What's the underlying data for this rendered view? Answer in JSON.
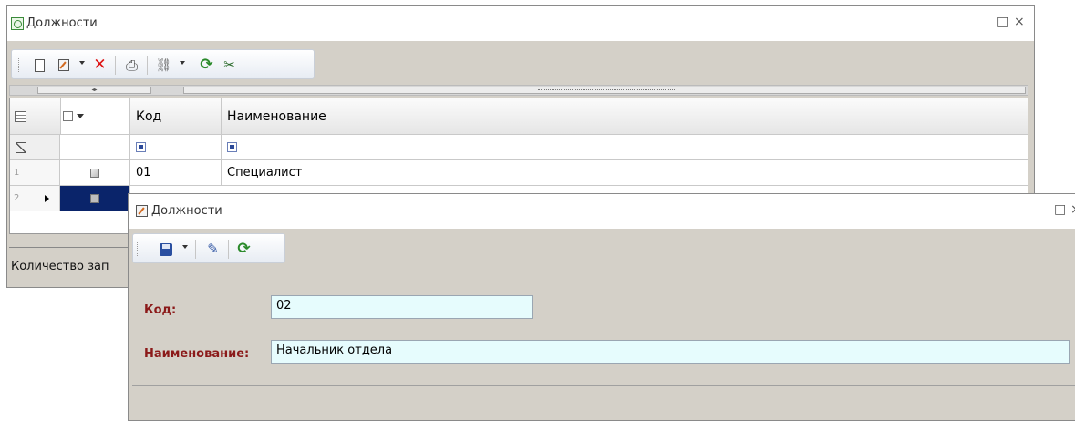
{
  "main_window": {
    "title": "Должности",
    "restore_icon": "restore-icon",
    "close_symbol": "×",
    "toolbar_icons": [
      "new-document-icon",
      "edit-icon",
      "delete-icon",
      "print-icon",
      "link-icon",
      "refresh-icon",
      "settings-icon"
    ],
    "grid": {
      "columns": [
        "Код",
        "Наименование"
      ],
      "rows": [
        {
          "num": "1",
          "code": "01",
          "name": "Специалист"
        },
        {
          "num": "2",
          "code": "",
          "name": ""
        }
      ]
    },
    "status_text": "Количество зап"
  },
  "edit_window": {
    "title": "Должности",
    "close_symbol": "×",
    "toolbar_icons": [
      "save-icon",
      "dropdown-arrow",
      "pen-icon",
      "refresh-icon"
    ],
    "fields": {
      "code_label": "Код:",
      "code_value": "02",
      "name_label": "Наименование:",
      "name_value": "Начальник отдела"
    }
  },
  "colors": {
    "label_text": "#8b1a1a",
    "input_bg": "#e6fcfd",
    "selected_row": "#0a246a",
    "window_bg": "#d4d0c8"
  }
}
